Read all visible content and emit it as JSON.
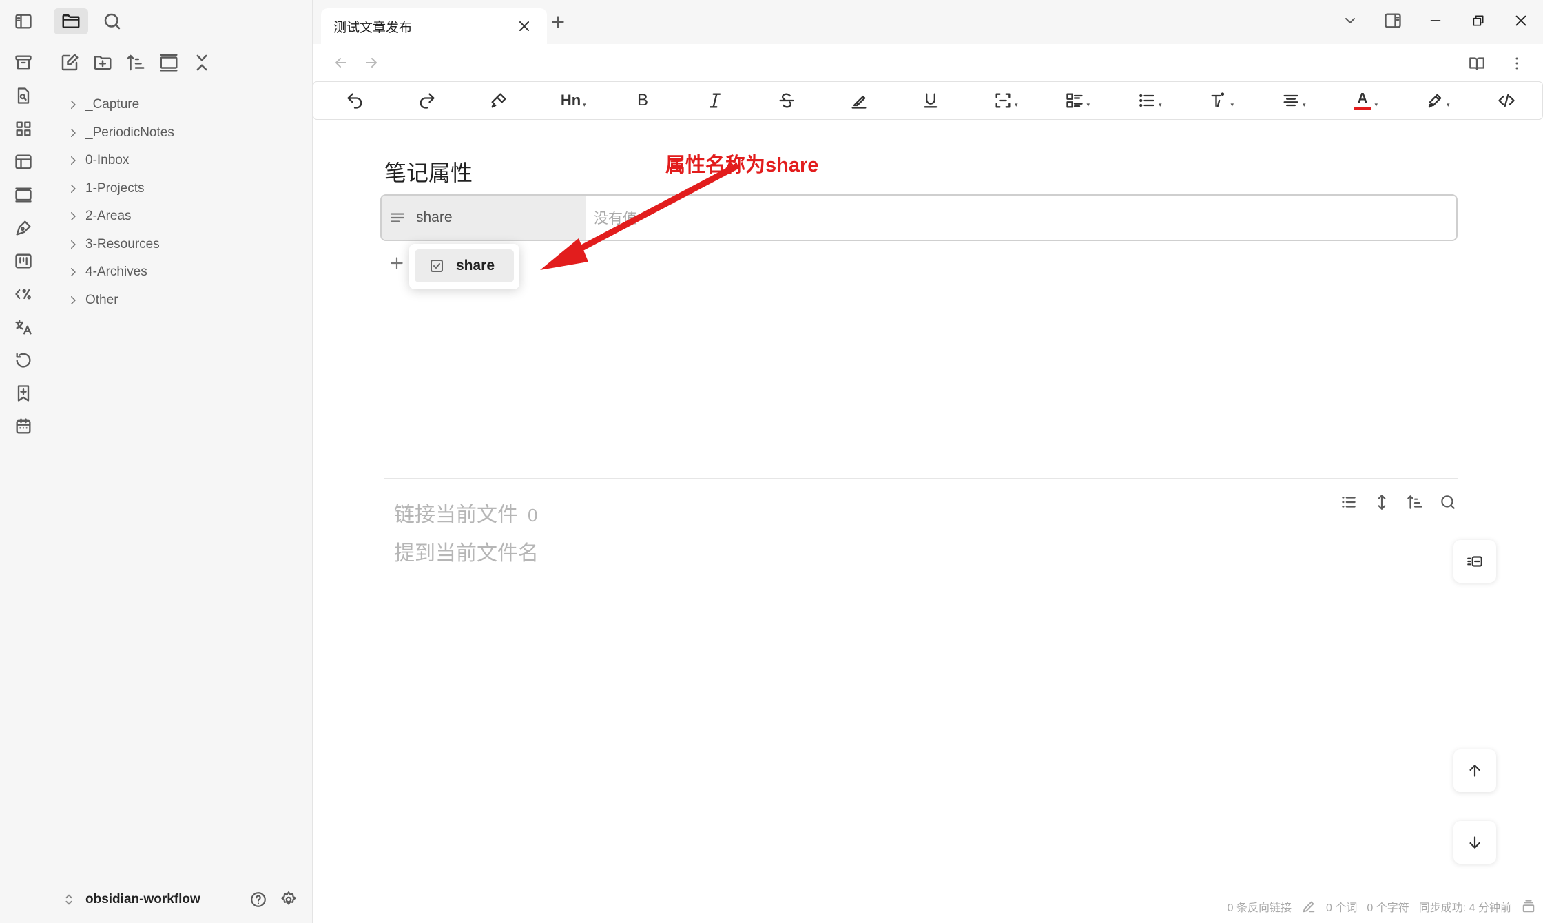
{
  "sidebar": {
    "tree": [
      "_Capture",
      "_PeriodicNotes",
      "0-Inbox",
      "1-Projects",
      "2-Areas",
      "3-Resources",
      "4-Archives",
      "Other"
    ],
    "vault_name": "obsidian-workflow"
  },
  "tab": {
    "title": "测试文章发布"
  },
  "toolbar": {
    "heading_label": "Hn",
    "bold_label": "B",
    "text_color_label": "A",
    "text_color": "#e21d1d"
  },
  "properties": {
    "heading": "笔记属性",
    "key": "share",
    "value_placeholder": "没有值",
    "suggestion": "share"
  },
  "annotation": {
    "text": "属性名称为share",
    "color": "#e21d1d"
  },
  "backlinks": {
    "linked_label": "链接当前文件",
    "linked_count": "0",
    "mentions_label": "提到当前文件名"
  },
  "status": {
    "backlinks": "0 条反向链接",
    "words": "0 个词",
    "chars": "0 个字符",
    "sync": "同步成功: 4 分钟前"
  }
}
